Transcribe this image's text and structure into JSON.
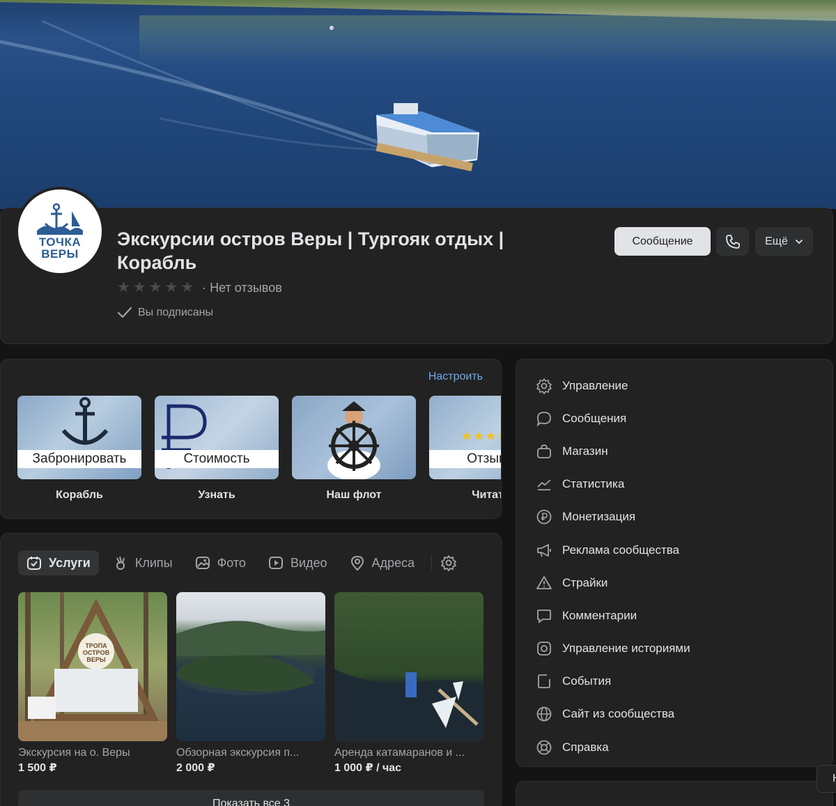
{
  "group": {
    "title": "Экскурсии остров Веры | Тургояк отдых | Корабль",
    "avatar_text": "ТОЧКА ВЕРЫ",
    "rating_stars": 0,
    "rating_text": "· Нет отзывов",
    "subscribed_text": "Вы подписаны"
  },
  "actions": {
    "message_label": "Сообщение",
    "more_label": "Ещё"
  },
  "widgets": {
    "configure_label": "Настроить",
    "tiles": [
      {
        "band": "Забронировать",
        "caption": "Корабль"
      },
      {
        "band": "Стоимость",
        "caption": "Узнать"
      },
      {
        "band": "",
        "caption": "Наш флот"
      },
      {
        "band": "Отзывы",
        "caption": "Читать"
      }
    ]
  },
  "tabs": [
    {
      "label": "Услуги",
      "active": true
    },
    {
      "label": "Клипы",
      "active": false
    },
    {
      "label": "Фото",
      "active": false
    },
    {
      "label": "Видео",
      "active": false
    },
    {
      "label": "Адреса",
      "active": false
    }
  ],
  "products": [
    {
      "name": "Экскурсия на о. Веры",
      "price": "1 500 ₽",
      "sign_text": "ТРОПА ОСТРОВ ВЕРЫ"
    },
    {
      "name": "Обзорная экскурсия п...",
      "price": "2 000 ₽"
    },
    {
      "name": "Аренда катамаранов и ...",
      "price": "1 000 ₽ / час"
    }
  ],
  "show_all_label": "Показать все 3",
  "menu": [
    {
      "label": "Управление",
      "icon": "gear-icon"
    },
    {
      "label": "Сообщения",
      "icon": "chat-bubble-icon"
    },
    {
      "label": "Магазин",
      "icon": "shopping-bag-icon"
    },
    {
      "label": "Статистика",
      "icon": "trend-chart-icon"
    },
    {
      "label": "Монетизация",
      "icon": "ruble-coin-icon"
    },
    {
      "label": "Реклама сообщества",
      "icon": "megaphone-icon"
    },
    {
      "label": "Страйки",
      "icon": "warning-icon"
    },
    {
      "label": "Комментарии",
      "icon": "comment-icon"
    },
    {
      "label": "Управление историями",
      "icon": "stories-icon"
    },
    {
      "label": "События",
      "icon": "calendar-icon"
    },
    {
      "label": "Сайт из сообщества",
      "icon": "globe-icon"
    },
    {
      "label": "Справка",
      "icon": "lifebuoy-icon"
    }
  ],
  "edge_button_label": "Н",
  "colors": {
    "accent": "#71aaeb",
    "card": "#222222",
    "background": "#141414",
    "text": "#e1e3e6",
    "muted": "#a2a5a9"
  }
}
